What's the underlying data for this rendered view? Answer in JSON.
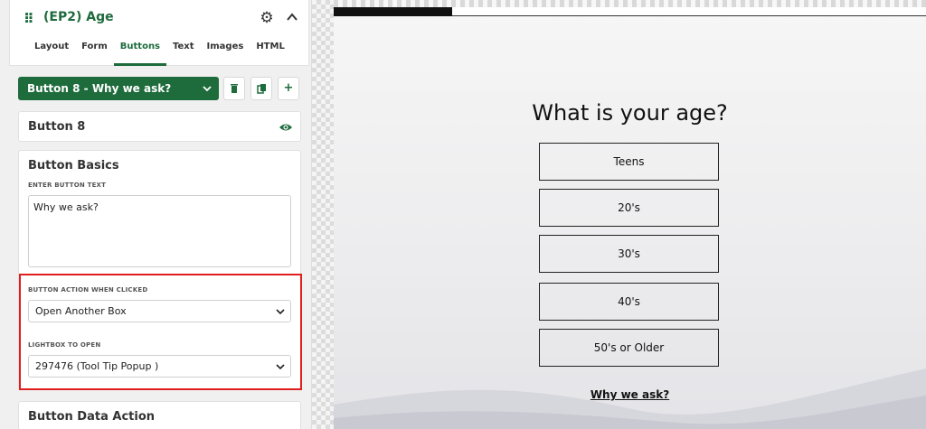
{
  "panel": {
    "box_title": "(EP2) Age",
    "tabs": [
      {
        "label": "Layout"
      },
      {
        "label": "Form"
      },
      {
        "label": "Buttons"
      },
      {
        "label": "Text"
      },
      {
        "label": "Images"
      },
      {
        "label": "HTML"
      }
    ],
    "active_tab": "Buttons",
    "button_select": "Button 8 - Why we ask?",
    "button_card_title": "Button 8",
    "basics": {
      "title": "Button Basics",
      "text_label": "ENTER BUTTON TEXT",
      "text_value": "Why we ask?",
      "action_label": "BUTTON ACTION WHEN CLICKED",
      "action_value": "Open Another Box",
      "lightbox_label": "LIGHTBOX TO OPEN",
      "lightbox_value": "297476 (Tool Tip Popup )"
    },
    "data_action_title": "Button Data Action",
    "accent_color": "#1e6b3c",
    "highlight_color": "#e01e1e"
  },
  "preview": {
    "progress_fraction": 0.2,
    "question": "What is your age?",
    "answers": [
      "Teens",
      "20's",
      "30's",
      "40's",
      "50's or Older"
    ],
    "why_link": "Why we ask?"
  },
  "icons": [
    "grip-icon",
    "gear-icon",
    "chevron-up-icon",
    "chevron-down-icon",
    "trash-icon",
    "copy-icon",
    "plus-icon",
    "eye-icon"
  ]
}
